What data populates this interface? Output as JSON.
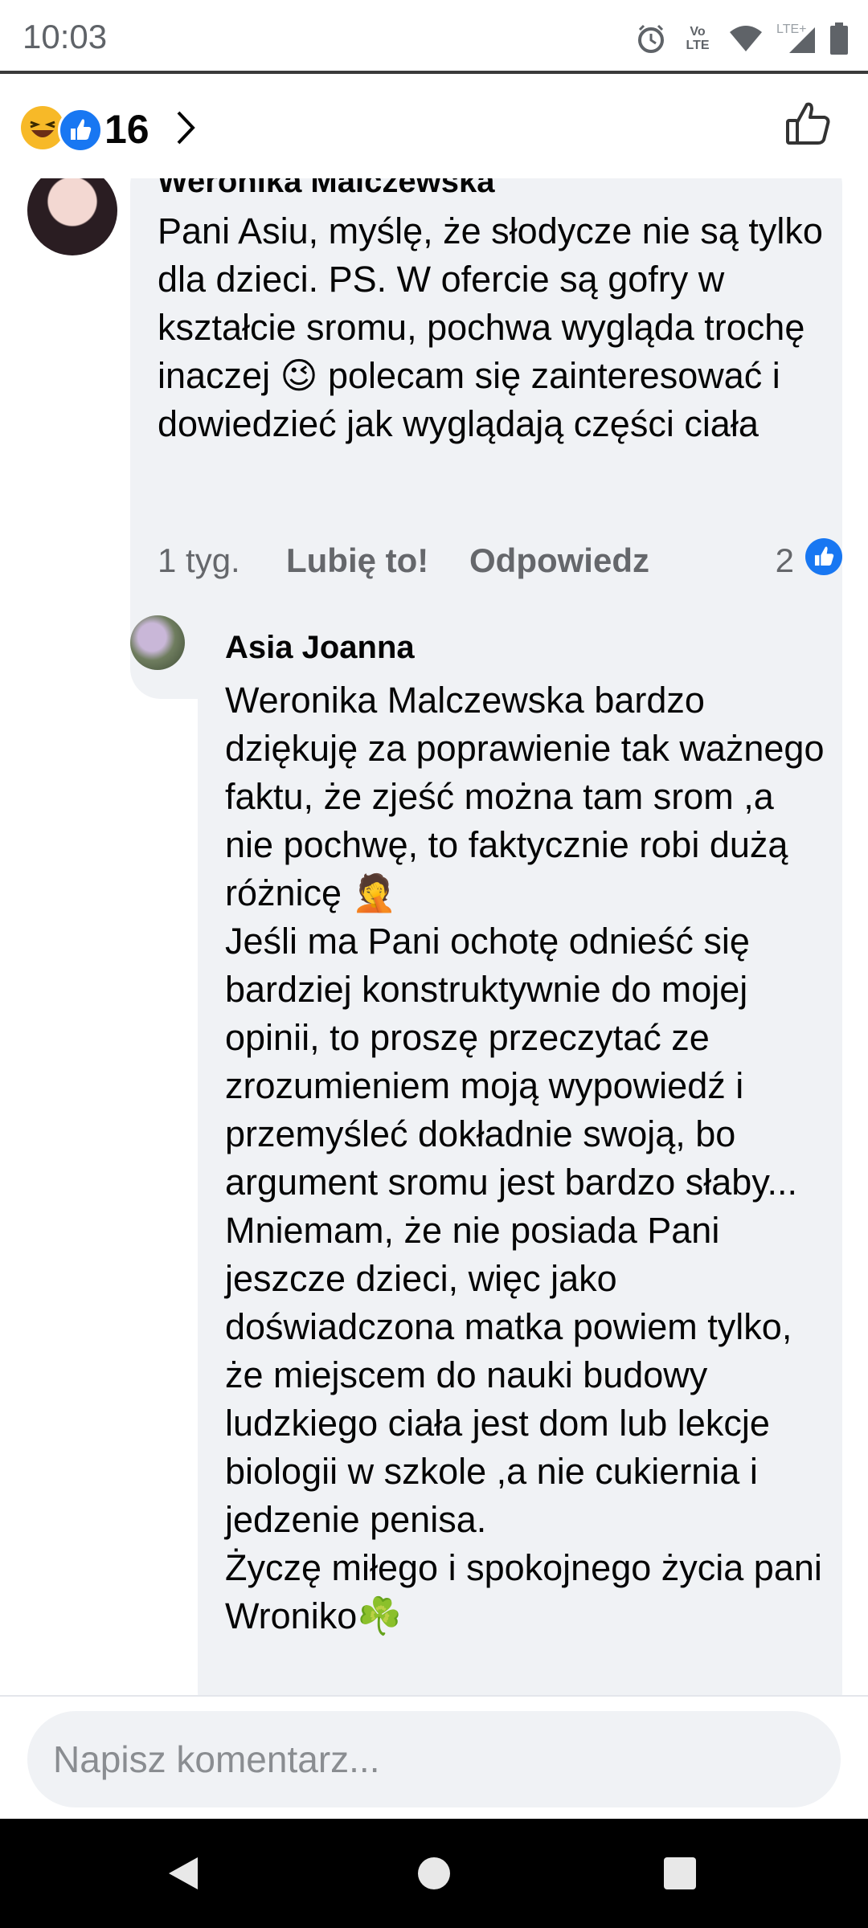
{
  "status_bar": {
    "time": "10:03",
    "icons": [
      "alarm-icon",
      "volte-icon",
      "wifi-icon",
      "lte-icon",
      "signal-icon",
      "battery-icon"
    ],
    "volte_label": "Vo LTE",
    "lte_label": "LTE+"
  },
  "header": {
    "reactions": [
      "haha",
      "like"
    ],
    "count": "16",
    "colors": {
      "like": "#1877f2",
      "haha": "#f7b928"
    }
  },
  "comments": [
    {
      "author": "Weronika Malczewska",
      "text": "Pani Asiu, myślę, że słodycze nie są tylko dla dzieci. PS. W ofercie są gofry w kształcie sromu, pochwa wygląda trochę inaczej 😉 polecam się zainteresować i dowiedzieć jak wyglądają części ciała",
      "time": "1 tyg.",
      "like_label": "Lubię to!",
      "reply_label": "Odpowiedz",
      "reaction_count": "2"
    },
    {
      "author": "Asia Joanna",
      "text": "Weronika Malczewska bardzo dziękuję za poprawienie tak ważnego faktu, że zjeść można tam srom ,a nie pochwę, to faktycznie robi dużą różnicę 🤦\nJeśli ma Pani ochotę odnieść się bardziej konstruktywnie do mojej opinii, to proszę przeczytać ze zrozumieniem moją wypowiedź i przemyśleć dokładnie swoją, bo argument sromu jest bardzo słaby...\nMniemam, że nie posiada Pani jeszcze dzieci, więc jako doświadczona matka powiem tylko, że miejscem do nauki budowy ludzkiego ciała jest dom lub lekcje biologii w szkole ,a nie cukiernia i jedzenie penisa.\nŻyczę miłego i spokojnego życia pani Wroniko☘️"
    }
  ],
  "composer": {
    "placeholder": "Napisz komentarz..."
  },
  "nav": {
    "buttons": [
      "back-icon",
      "home-icon",
      "recents-icon"
    ]
  }
}
